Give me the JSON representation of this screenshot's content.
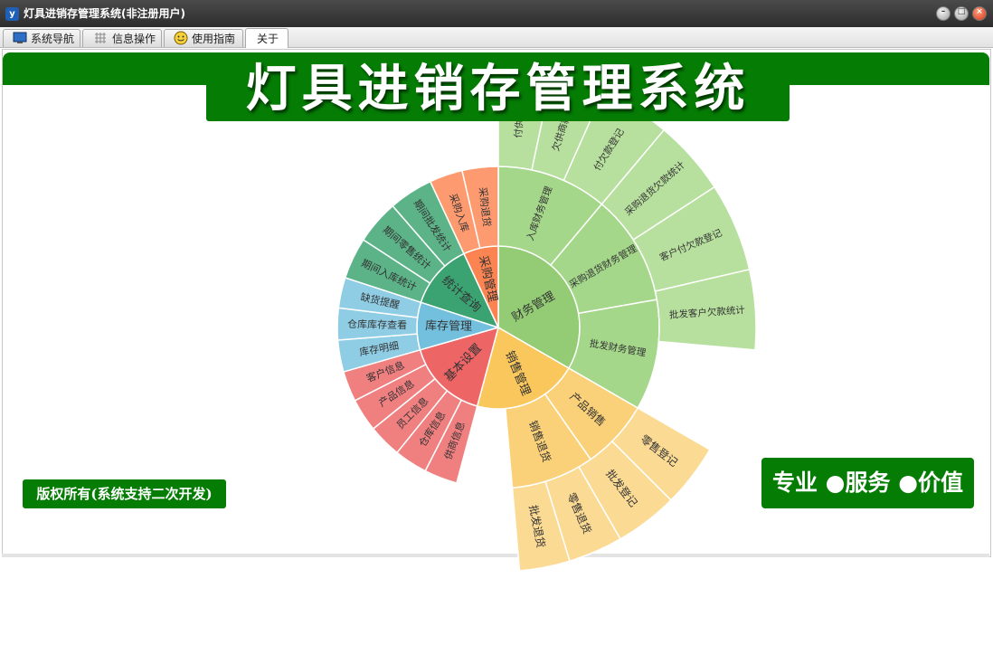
{
  "window": {
    "title": "灯具进销存管理系统(非注册用户)",
    "icon": "app-logo-icon"
  },
  "tabs": [
    {
      "label": "系统导航",
      "icon": "monitor-icon"
    },
    {
      "label": "信息操作",
      "icon": "grid-icon"
    },
    {
      "label": "使用指南",
      "icon": "smiley-icon"
    },
    {
      "label": "关于",
      "icon": ""
    }
  ],
  "header": {
    "title": "灯具进销存管理系统"
  },
  "footer": {
    "copyright": "版权所有(系统支持二次开发)",
    "slogan": "专业 ●服务 ●价值"
  },
  "colors": {
    "brand_green": "#057d05",
    "finance": "#93cc74",
    "sales": "#f9c75c",
    "basic": "#ee6566",
    "inventory": "#73c0de",
    "statistics": "#3ba272",
    "purchase": "#fc8452"
  },
  "chart_data": {
    "type": "sunburst",
    "categories": [
      {
        "name": "财务管理",
        "children": [
          "入库财务管理",
          "采购退货财务管理",
          "批发财务管理"
        ],
        "leaves": [
          "付供商欠",
          "欠供商款额",
          "付欠款登记",
          "采购退货欠款统计",
          "客户付欠款登记",
          "批发客户欠款统计"
        ]
      },
      {
        "name": "销售管理",
        "children": [
          "产品销售",
          "销售退货"
        ],
        "leaves": [
          "零售登记",
          "批发登记",
          "零售退货",
          "批发退货"
        ]
      },
      {
        "name": "基本设置",
        "children": [
          "供商信息",
          "仓库信息",
          "员工信息",
          "产品信息",
          "客户信息"
        ]
      },
      {
        "name": "库存管理",
        "children": [
          "库存明细",
          "仓库库存查看",
          "缺货提醒"
        ]
      },
      {
        "name": "统计查询",
        "children": [
          "期间入库统计",
          "期间零售统计",
          "期间批发统计"
        ]
      },
      {
        "name": "采购管理",
        "children": [
          "采购入库",
          "采购退货"
        ]
      }
    ]
  }
}
